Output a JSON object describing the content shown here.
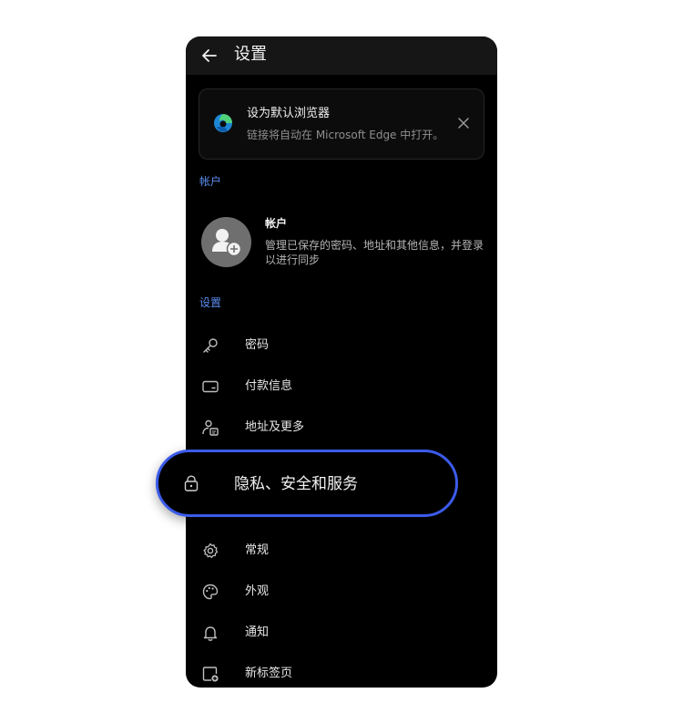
{
  "header": {
    "title": "设置",
    "back_icon": "arrow-left-icon"
  },
  "banner": {
    "title": "设为默认浏览器",
    "subtitle": "链接将自动在 Microsoft Edge 中打开。",
    "icon": "edge-logo-icon",
    "close_icon": "close-icon"
  },
  "account_section": {
    "label": "帐户",
    "title": "帐户",
    "description": "管理已保存的密码、地址和其他信息，并登录以进行同步",
    "icon": "add-user-icon"
  },
  "settings_section": {
    "label": "设置",
    "items": [
      {
        "label": "密码",
        "icon": "key-icon"
      },
      {
        "label": "付款信息",
        "icon": "card-icon"
      },
      {
        "label": "地址及更多",
        "icon": "address-icon"
      },
      {
        "label": "隐私、安全和服务",
        "icon": "lock-icon",
        "highlighted": true
      },
      {
        "label": "常规",
        "icon": "gear-icon"
      },
      {
        "label": "外观",
        "icon": "palette-icon"
      },
      {
        "label": "通知",
        "icon": "bell-icon"
      },
      {
        "label": "新标签页",
        "icon": "new-tab-icon"
      }
    ]
  },
  "colors": {
    "accent": "#5b8def",
    "highlight_border": "#3b5bea",
    "background": "#000000"
  }
}
